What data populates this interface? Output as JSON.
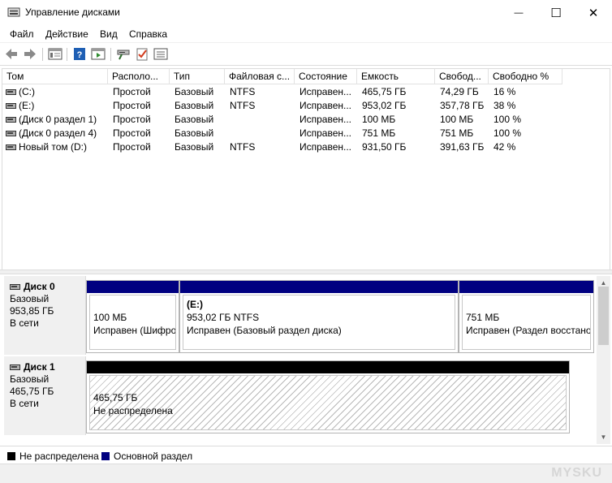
{
  "window": {
    "title": "Управление дисками",
    "minimize_glyph": "—",
    "maximize_glyph": "☐",
    "close_glyph": "✕"
  },
  "menu": [
    "Файл",
    "Действие",
    "Вид",
    "Справка"
  ],
  "toolbar_icons": [
    "back-icon",
    "forward-icon",
    "console-tree-icon",
    "help-icon",
    "show-hide-action-pane-icon",
    "connect-icon",
    "checkmark-icon",
    "properties-list-icon"
  ],
  "volumes": {
    "columns": [
      "Том",
      "Располо...",
      "Тип",
      "Файловая с...",
      "Состояние",
      "Емкость",
      "Свобод...",
      "Свободно %"
    ],
    "rows": [
      [
        "(C:)",
        "Простой",
        "Базовый",
        "NTFS",
        "Исправен...",
        "465,75 ГБ",
        "74,29 ГБ",
        "16 %"
      ],
      [
        "(E:)",
        "Простой",
        "Базовый",
        "NTFS",
        "Исправен...",
        "953,02 ГБ",
        "357,78 ГБ",
        "38 %"
      ],
      [
        "(Диск 0 раздел 1)",
        "Простой",
        "Базовый",
        "",
        "Исправен...",
        "100 МБ",
        "100 МБ",
        "100 %"
      ],
      [
        "(Диск 0 раздел 4)",
        "Простой",
        "Базовый",
        "",
        "Исправен...",
        "751 МБ",
        "751 МБ",
        "100 %"
      ],
      [
        "Новый том (D:)",
        "Простой",
        "Базовый",
        "NTFS",
        "Исправен...",
        "931,50 ГБ",
        "391,63 ГБ",
        "42 %"
      ]
    ]
  },
  "disks": [
    {
      "name": "Диск 0",
      "type": "Базовый",
      "size": "953,85 ГБ",
      "status": "В сети",
      "partitions": [
        {
          "title": "",
          "size": "100 МБ",
          "status": "Исправен (Шифро"
        },
        {
          "title": "(E:)",
          "size": "953,02 ГБ NTFS",
          "status": "Исправен (Базовый раздел диска)"
        },
        {
          "title": "",
          "size": "751 МБ",
          "status": "Исправен (Раздел восстано"
        }
      ]
    },
    {
      "name": "Диск 1",
      "type": "Базовый",
      "size": "465,75 ГБ",
      "status": "В сети",
      "partitions": [
        {
          "title": "",
          "size": "465,75 ГБ",
          "status": "Не распределена"
        }
      ]
    }
  ],
  "legend": [
    {
      "label": "Не распределена",
      "color": "#000000"
    },
    {
      "label": "Основной раздел",
      "color": "#000080"
    }
  ],
  "colors": {
    "primary_partition": "#000080",
    "unallocated": "#000000",
    "toolbar_help": "#1e5fb4"
  },
  "watermark": "MYSKU"
}
